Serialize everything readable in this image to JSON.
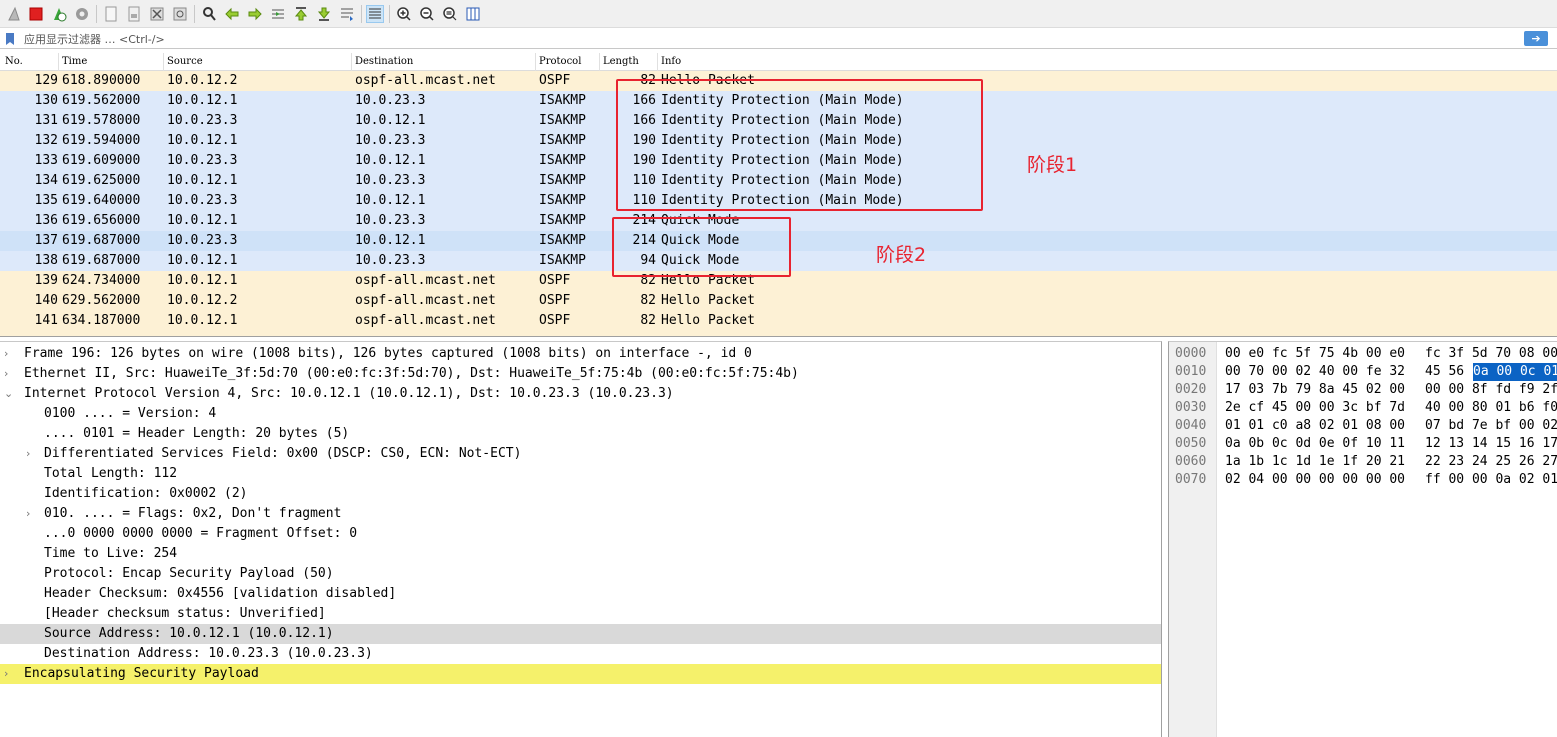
{
  "toolbar": {
    "buttons": [
      "shark-fin-start-icon",
      "stop-capture-icon",
      "restart-capture-icon",
      "capture-options-icon",
      "open-file-icon",
      "save-file-icon",
      "close-file-icon",
      "reload-file-icon",
      "find-packet-icon",
      "go-back-icon",
      "go-forward-icon",
      "go-to-packet-icon",
      "go-first-icon",
      "go-last-icon",
      "auto-scroll-icon",
      "colorize-icon",
      "zoom-in-icon",
      "zoom-out-icon",
      "zoom-normal-icon",
      "resize-columns-icon"
    ]
  },
  "filter": {
    "placeholder": "应用显示过滤器 … <Ctrl-/>",
    "apply_label": "➔"
  },
  "columns": {
    "no": "No.",
    "time": "Time",
    "source": "Source",
    "destination": "Destination",
    "protocol": "Protocol",
    "length": "Length",
    "info": "Info"
  },
  "packets": [
    {
      "no": "129",
      "time": "618.890000",
      "src": "10.0.12.2",
      "dst": "ospf-all.mcast.net",
      "proto": "OSPF",
      "len": "82",
      "info": "Hello Packet",
      "bg": "#fdf1d5"
    },
    {
      "no": "130",
      "time": "619.562000",
      "src": "10.0.12.1",
      "dst": "10.0.23.3",
      "proto": "ISAKMP",
      "len": "166",
      "info": "Identity Protection (Main Mode)",
      "bg": "#dde9fa"
    },
    {
      "no": "131",
      "time": "619.578000",
      "src": "10.0.23.3",
      "dst": "10.0.12.1",
      "proto": "ISAKMP",
      "len": "166",
      "info": "Identity Protection (Main Mode)",
      "bg": "#dde9fa"
    },
    {
      "no": "132",
      "time": "619.594000",
      "src": "10.0.12.1",
      "dst": "10.0.23.3",
      "proto": "ISAKMP",
      "len": "190",
      "info": "Identity Protection (Main Mode)",
      "bg": "#dde9fa"
    },
    {
      "no": "133",
      "time": "619.609000",
      "src": "10.0.23.3",
      "dst": "10.0.12.1",
      "proto": "ISAKMP",
      "len": "190",
      "info": "Identity Protection (Main Mode)",
      "bg": "#dde9fa"
    },
    {
      "no": "134",
      "time": "619.625000",
      "src": "10.0.12.1",
      "dst": "10.0.23.3",
      "proto": "ISAKMP",
      "len": "110",
      "info": "Identity Protection (Main Mode)",
      "bg": "#dde9fa"
    },
    {
      "no": "135",
      "time": "619.640000",
      "src": "10.0.23.3",
      "dst": "10.0.12.1",
      "proto": "ISAKMP",
      "len": "110",
      "info": "Identity Protection (Main Mode)",
      "bg": "#dde9fa"
    },
    {
      "no": "136",
      "time": "619.656000",
      "src": "10.0.12.1",
      "dst": "10.0.23.3",
      "proto": "ISAKMP",
      "len": "214",
      "info": "Quick Mode",
      "bg": "#dde9fa"
    },
    {
      "no": "137",
      "time": "619.687000",
      "src": "10.0.23.3",
      "dst": "10.0.12.1",
      "proto": "ISAKMP",
      "len": "214",
      "info": "Quick Mode",
      "bg": "#cfe2f8"
    },
    {
      "no": "138",
      "time": "619.687000",
      "src": "10.0.12.1",
      "dst": "10.0.23.3",
      "proto": "ISAKMP",
      "len": "94",
      "info": "Quick Mode",
      "bg": "#dde9fa"
    },
    {
      "no": "139",
      "time": "624.734000",
      "src": "10.0.12.1",
      "dst": "ospf-all.mcast.net",
      "proto": "OSPF",
      "len": "82",
      "info": "Hello Packet",
      "bg": "#fdf1d5"
    },
    {
      "no": "140",
      "time": "629.562000",
      "src": "10.0.12.2",
      "dst": "ospf-all.mcast.net",
      "proto": "OSPF",
      "len": "82",
      "info": "Hello Packet",
      "bg": "#fdf1d5"
    },
    {
      "no": "141",
      "time": "634.187000",
      "src": "10.0.12.1",
      "dst": "ospf-all.mcast.net",
      "proto": "OSPF",
      "len": "82",
      "info": "Hello Packet",
      "bg": "#fdf1d5"
    }
  ],
  "annotations": {
    "phase1": "阶段1",
    "phase2": "阶段2",
    "color": "#e8232f"
  },
  "details": [
    {
      "level": 0,
      "arrow": "›",
      "text": "Frame 196: 126 bytes on wire (1008 bits), 126 bytes captured (1008 bits) on interface -, id 0",
      "bg": "#ffffff"
    },
    {
      "level": 0,
      "arrow": "›",
      "text": "Ethernet II, Src: HuaweiTe_3f:5d:70 (00:e0:fc:3f:5d:70), Dst: HuaweiTe_5f:75:4b (00:e0:fc:5f:75:4b)",
      "bg": "#ffffff"
    },
    {
      "level": 0,
      "arrow": "⌄",
      "text": "Internet Protocol Version 4, Src: 10.0.12.1 (10.0.12.1), Dst: 10.0.23.3 (10.0.23.3)",
      "bg": "#ffffff"
    },
    {
      "level": 1,
      "arrow": "",
      "text": "0100 .... = Version: 4",
      "bg": "#ffffff"
    },
    {
      "level": 1,
      "arrow": "",
      "text": ".... 0101 = Header Length: 20 bytes (5)",
      "bg": "#ffffff"
    },
    {
      "level": 1,
      "arrow": "›",
      "text": "Differentiated Services Field: 0x00 (DSCP: CS0, ECN: Not-ECT)",
      "bg": "#ffffff"
    },
    {
      "level": 1,
      "arrow": "",
      "text": "Total Length: 112",
      "bg": "#ffffff"
    },
    {
      "level": 1,
      "arrow": "",
      "text": "Identification: 0x0002 (2)",
      "bg": "#ffffff"
    },
    {
      "level": 1,
      "arrow": "›",
      "text": "010. .... = Flags: 0x2, Don't fragment",
      "bg": "#ffffff"
    },
    {
      "level": 1,
      "arrow": "",
      "text": "...0 0000 0000 0000 = Fragment Offset: 0",
      "bg": "#ffffff"
    },
    {
      "level": 1,
      "arrow": "",
      "text": "Time to Live: 254",
      "bg": "#ffffff"
    },
    {
      "level": 1,
      "arrow": "",
      "text": "Protocol: Encap Security Payload (50)",
      "bg": "#ffffff"
    },
    {
      "level": 1,
      "arrow": "",
      "text": "Header Checksum: 0x4556 [validation disabled]",
      "bg": "#ffffff"
    },
    {
      "level": 1,
      "arrow": "",
      "text": "[Header checksum status: Unverified]",
      "bg": "#ffffff"
    },
    {
      "level": 1,
      "arrow": "",
      "text": "Source Address: 10.0.12.1 (10.0.12.1)",
      "bg": "#d9d9d9"
    },
    {
      "level": 1,
      "arrow": "",
      "text": "Destination Address: 10.0.23.3 (10.0.23.3)",
      "bg": "#ffffff"
    },
    {
      "level": 0,
      "arrow": "›",
      "text": "Encapsulating Security Payload",
      "bg": "#f5f16b"
    }
  ],
  "hex": [
    {
      "off": "0000",
      "b1": "00 e0 fc 5f 75 4b 00 e0",
      "b2": "fc 3f 5d 70 08 00",
      "b3": ""
    },
    {
      "off": "0010",
      "b1": "00 70 00 02 40 00 fe 32",
      "b2": "45 56",
      "b3": "0a 00 0c 01"
    },
    {
      "off": "0020",
      "b1": "17 03 7b 79 8a 45 02 00",
      "b2": "00 00 8f fd f9 2f",
      "b3": ""
    },
    {
      "off": "0030",
      "b1": "2e cf 45 00 00 3c bf 7d",
      "b2": "40 00 80 01 b6 f0",
      "b3": ""
    },
    {
      "off": "0040",
      "b1": "01 01 c0 a8 02 01 08 00",
      "b2": "07 bd 7e bf 00 02",
      "b3": ""
    },
    {
      "off": "0050",
      "b1": "0a 0b 0c 0d 0e 0f 10 11",
      "b2": "12 13 14 15 16 17",
      "b3": ""
    },
    {
      "off": "0060",
      "b1": "1a 1b 1c 1d 1e 1f 20 21",
      "b2": "22 23 24 25 26 27",
      "b3": ""
    },
    {
      "off": "0070",
      "b1": "02 04 00 00 00 00 00 00",
      "b2": "ff 00 00 0a 02 01",
      "b3": ""
    }
  ]
}
